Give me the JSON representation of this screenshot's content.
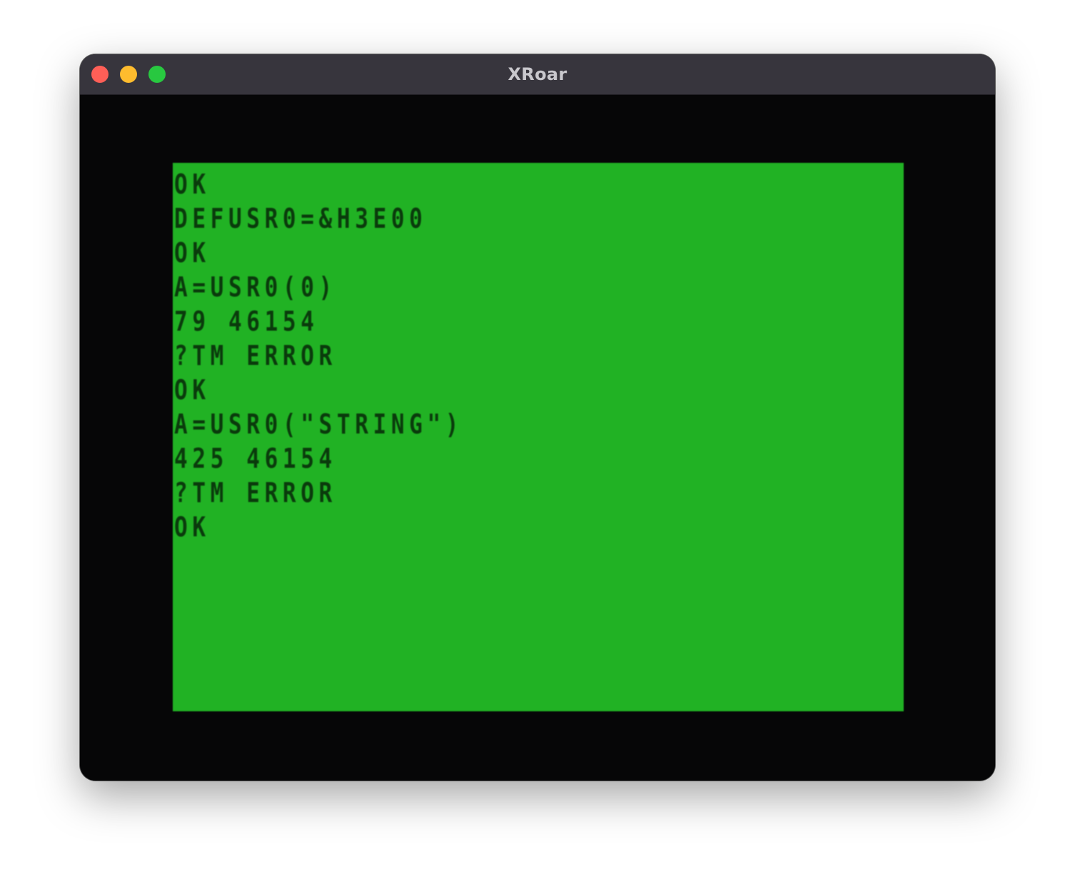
{
  "window": {
    "title": "XRoar",
    "traffic_colors": {
      "close": "#fe5f57",
      "minimize": "#febc2e",
      "zoom": "#28c840"
    }
  },
  "screen": {
    "background_color": "#21b224",
    "text_color": "#0a3a0c",
    "lines": [
      "OK",
      "DEFUSR0=&H3E00",
      "OK",
      "A=USR0(0)",
      "79 46154",
      "?TM ERROR",
      "OK",
      "A=USR0(\"STRING\")",
      "425 46154",
      "?TM ERROR",
      "OK"
    ]
  }
}
